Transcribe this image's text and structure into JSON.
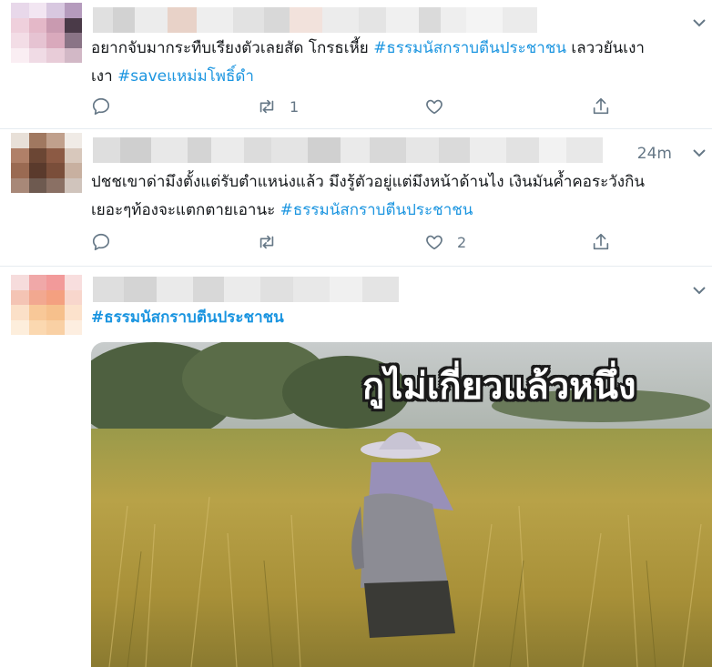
{
  "tweets": [
    {
      "text_plain": "อยากจับมากระทืบเรียงตัวเลยสัด โกรธเหี้ย ",
      "hashtag1": "#ธรรมนัสกราบตีนประชาชน",
      "text_after": "  เลววยันเงา ",
      "hashtag2": "#saveแหม่มโพธิ์ดำ",
      "retweet_count": "1",
      "like_count": ""
    },
    {
      "time": "24m",
      "text_line1": "ปชชเขาด่ามึงตั้งแต่รับตำแหน่งแล้ว มึงรู้ตัวอยู่แต่มึงหน้าด้านไง เงินมันค้ำคอระวังกิน",
      "text_line2": "เยอะๆท้องจะแตกตายเอานะ  ",
      "hashtag1": "#ธรรมนัสกราบตีนประชาชน",
      "retweet_count": "",
      "like_count": "2"
    },
    {
      "hashtag1": "#ธรรมนัสกราบตีนประชาชน",
      "media_caption": "กูไม่เกี่ยวแล้วหนึ่ง"
    }
  ],
  "icons": {
    "reply": "reply-icon",
    "retweet": "retweet-icon",
    "like": "heart-icon",
    "share": "share-icon",
    "more": "chevron-down-icon"
  },
  "colors": {
    "hashtag": "#1b95e0",
    "muted": "#657786",
    "divider": "#e6ecf0"
  }
}
